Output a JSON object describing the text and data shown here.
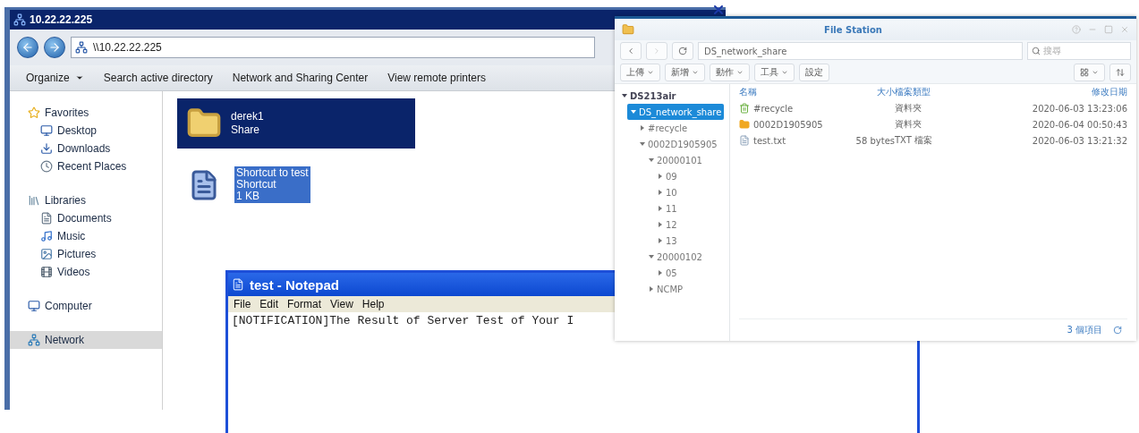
{
  "explorer": {
    "title": "10.22.22.225",
    "address": "\\\\10.22.22.225",
    "toolbar": [
      {
        "label": "Organize",
        "dropdown": true
      },
      {
        "label": "Search active directory",
        "dropdown": false
      },
      {
        "label": "Network and Sharing Center",
        "dropdown": false
      },
      {
        "label": "View remote printers",
        "dropdown": false
      }
    ],
    "nav_groups": [
      {
        "label": "Favorites",
        "kind": "favorites",
        "selected": false,
        "items": [
          {
            "label": "Desktop",
            "kind": "desktop"
          },
          {
            "label": "Downloads",
            "kind": "downloads"
          },
          {
            "label": "Recent Places",
            "kind": "recent"
          }
        ]
      },
      {
        "label": "Libraries",
        "kind": "libraries",
        "selected": false,
        "items": [
          {
            "label": "Documents",
            "kind": "documents"
          },
          {
            "label": "Music",
            "kind": "music"
          },
          {
            "label": "Pictures",
            "kind": "pictures"
          },
          {
            "label": "Videos",
            "kind": "videos"
          }
        ]
      },
      {
        "label": "Computer",
        "kind": "computer",
        "selected": false
      },
      {
        "label": "Network",
        "kind": "network",
        "selected": true
      }
    ],
    "items": [
      {
        "kind": "share",
        "lines": [
          "derek1",
          "Share"
        ],
        "selected": true
      },
      {
        "kind": "shortcut",
        "lines": [
          "Shortcut to test",
          "Shortcut",
          "1 KB"
        ],
        "selected": true
      }
    ]
  },
  "notepad": {
    "title": "test - Notepad",
    "menu": [
      "File",
      "Edit",
      "Format",
      "View",
      "Help"
    ],
    "text": "[NOTIFICATION]The Result of Server Test of Your I"
  },
  "file_station": {
    "title": "File Station",
    "path": "DS_network_share",
    "search_placeholder": "搜尋",
    "toolbar": [
      {
        "label": "上傳",
        "dropdown": true
      },
      {
        "label": "新增",
        "dropdown": true
      },
      {
        "label": "動作",
        "dropdown": true
      },
      {
        "label": "工具",
        "dropdown": true
      },
      {
        "label": "設定",
        "dropdown": false
      }
    ],
    "tree": [
      {
        "label": "DS213air",
        "expanded": true,
        "selected": false,
        "children": [
          {
            "label": "DS_network_share",
            "expanded": true,
            "selected": true,
            "children": [
              {
                "label": "#recycle",
                "expanded": false,
                "selected": false
              },
              {
                "label": "0002D1905905",
                "expanded": true,
                "selected": false,
                "children": [
                  {
                    "label": "20000101",
                    "expanded": true,
                    "selected": false,
                    "children": [
                      {
                        "label": "09",
                        "expanded": false,
                        "selected": false
                      },
                      {
                        "label": "10",
                        "expanded": false,
                        "selected": false
                      },
                      {
                        "label": "11",
                        "expanded": false,
                        "selected": false
                      },
                      {
                        "label": "12",
                        "expanded": false,
                        "selected": false
                      },
                      {
                        "label": "13",
                        "expanded": false,
                        "selected": false
                      }
                    ]
                  },
                  {
                    "label": "20000102",
                    "expanded": true,
                    "selected": false,
                    "children": [
                      {
                        "label": "05",
                        "expanded": false,
                        "selected": false
                      }
                    ]
                  },
                  {
                    "label": "NCMP",
                    "expanded": false,
                    "selected": false
                  }
                ]
              }
            ]
          }
        ]
      }
    ],
    "columns": [
      "名稱",
      "大小",
      "檔案類型",
      "修改日期"
    ],
    "rows": [
      {
        "kind": "recycle",
        "name": "#recycle",
        "size": "",
        "type": "資料夾",
        "modified": "2020-06-03 13:23:06"
      },
      {
        "kind": "folder",
        "name": "0002D1905905",
        "size": "",
        "type": "資料夾",
        "modified": "2020-06-04 00:50:43"
      },
      {
        "kind": "file",
        "name": "test.txt",
        "size": "58 bytes",
        "type": "TXT 檔案",
        "modified": "2020-06-03 13:21:32"
      }
    ],
    "footer": "3 個項目"
  }
}
